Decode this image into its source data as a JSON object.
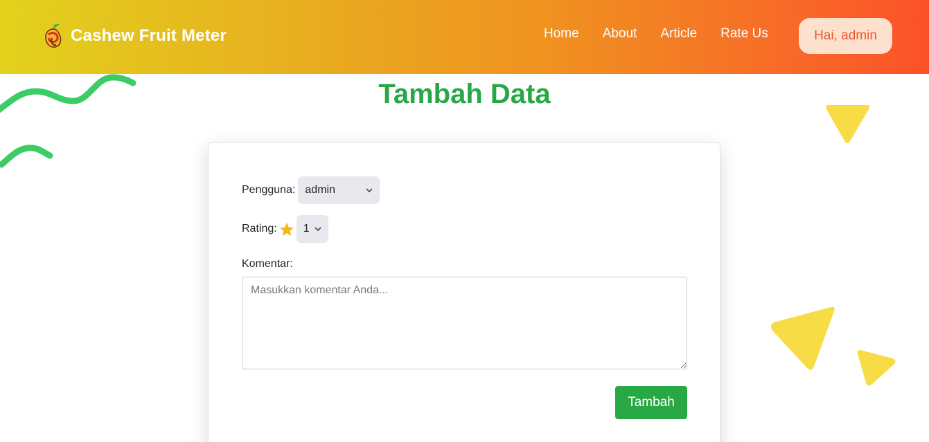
{
  "navbar": {
    "brand": "Cashew Fruit Meter",
    "links": [
      "Home",
      "About",
      "Article",
      "Rate Us"
    ],
    "user_greeting": "Hai, admin"
  },
  "page": {
    "title": "Tambah Data"
  },
  "form": {
    "user_label": "Pengguna:",
    "user_selected": "admin",
    "rating_label": "Rating:",
    "rating_selected": "1",
    "comment_label": "Komentar:",
    "comment_placeholder": "Masukkan komentar Anda...",
    "comment_value": "",
    "submit_label": "Tambah"
  },
  "colors": {
    "accent_green": "#28a745",
    "header_gradient_start": "#e2d21c",
    "header_gradient_end": "#fc5128",
    "decoration_yellow": "#f7dc45",
    "decoration_green": "#3ccc66"
  },
  "icons": {
    "brand": "cashew-fruit-icon",
    "rating": "star-icon",
    "select": "chevron-down-icon"
  }
}
